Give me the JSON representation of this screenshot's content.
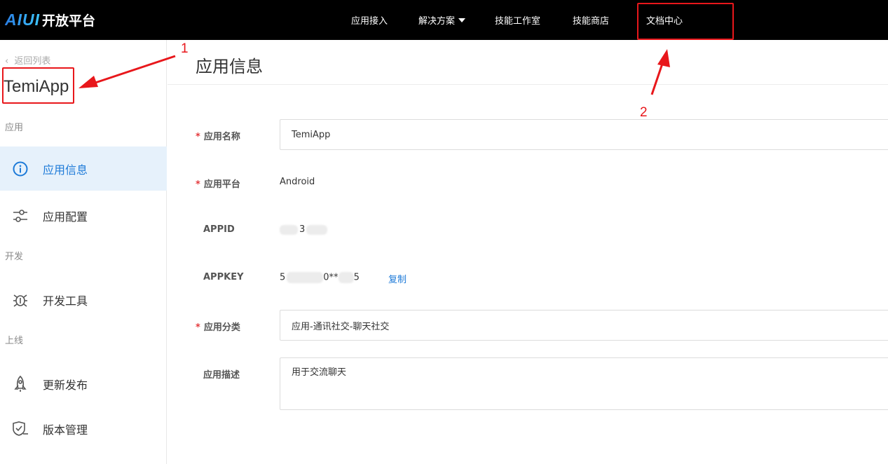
{
  "brand": {
    "logo_mark": "AIUI",
    "logo_text": "开放平台"
  },
  "topnav": {
    "items": [
      "应用接入",
      "解决方案",
      "技能工作室",
      "技能商店",
      "文档中心"
    ]
  },
  "sidebar": {
    "back_label": "返回列表",
    "app_name": "TemiApp",
    "sections": {
      "app": "应用",
      "dev": "开发",
      "online": "上线"
    },
    "items": [
      {
        "label": "应用信息",
        "icon": "info-icon",
        "active": true
      },
      {
        "label": "应用配置",
        "icon": "sliders-icon",
        "active": false
      },
      {
        "label": "开发工具",
        "icon": "bug-icon",
        "active": false
      },
      {
        "label": "更新发布",
        "icon": "rocket-icon",
        "active": false
      },
      {
        "label": "版本管理",
        "icon": "shield-check-icon",
        "active": false
      }
    ]
  },
  "main": {
    "title": "应用信息",
    "fields": {
      "name": {
        "label": "应用名称",
        "value": "TemiApp",
        "required": true
      },
      "platform": {
        "label": "应用平台",
        "value": "Android",
        "required": true
      },
      "appid": {
        "label": "APPID",
        "value": "3"
      },
      "appkey": {
        "label": "APPKEY",
        "value_prefix": "5",
        "value_mid": "0**",
        "value_suffix": "5",
        "copy_label": "复制"
      },
      "category": {
        "label": "应用分类",
        "value": "应用-通讯社交-聊天社交",
        "required": true
      },
      "description": {
        "label": "应用描述",
        "value": "用于交流聊天"
      }
    }
  },
  "annotations": {
    "label_1": "1",
    "label_2": "2",
    "color": "#e8171b"
  },
  "colors": {
    "accent": "#1d7ad8",
    "active_bg": "#e6f1fb",
    "topbar_bg": "#000000",
    "required": "#e4393c"
  }
}
